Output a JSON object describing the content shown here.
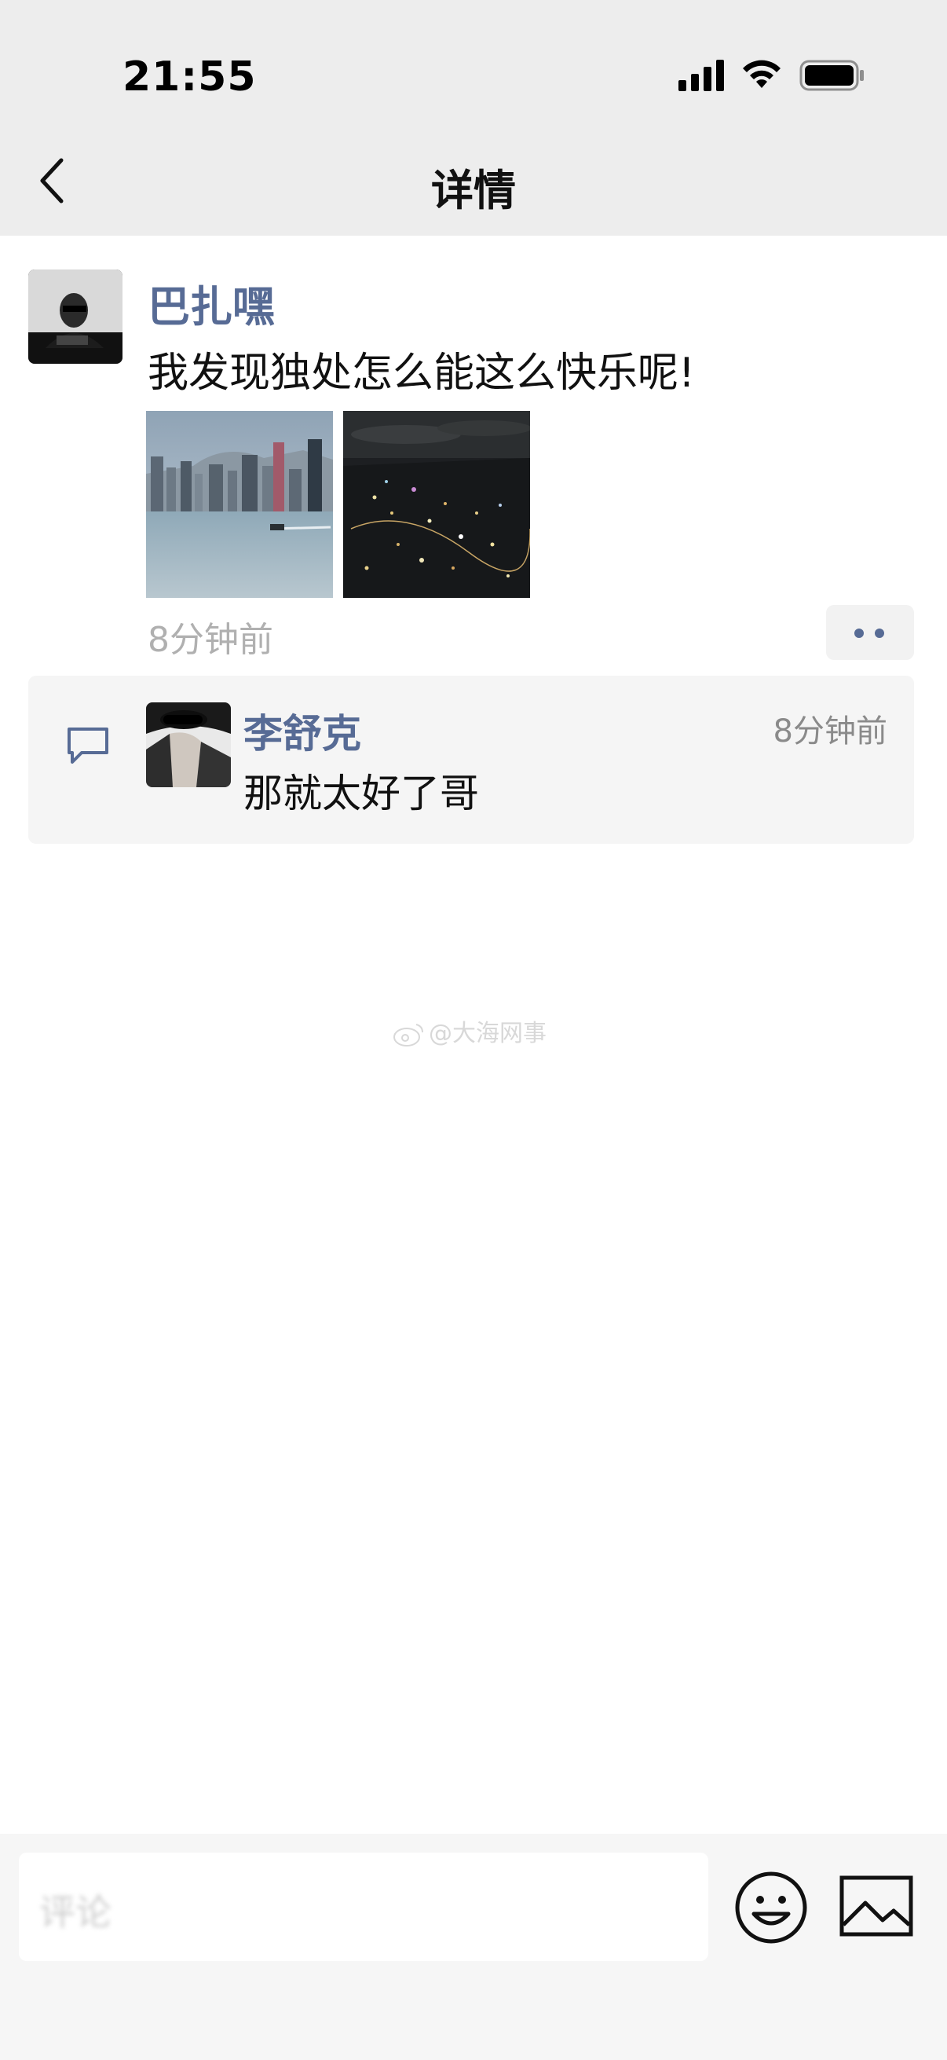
{
  "status_bar": {
    "time": "21:55"
  },
  "nav": {
    "title": "详情",
    "back_icon": "chevron-left-icon"
  },
  "post": {
    "author": "巴扎嘿",
    "text": "我发现独处怎么能这么快乐呢!",
    "images": [
      "city-skyline-harbor-photo",
      "night-city-aerial-photo"
    ],
    "time": "8分钟前",
    "more_icon": "more-dots-icon"
  },
  "comments": [
    {
      "author": "李舒克",
      "text": "那就太好了哥",
      "time": "8分钟前"
    }
  ],
  "watermark": "@大海网事",
  "input": {
    "placeholder": "评论"
  },
  "colors": {
    "link": "#576b95",
    "background": "#ffffff",
    "bar": "#ededed"
  }
}
